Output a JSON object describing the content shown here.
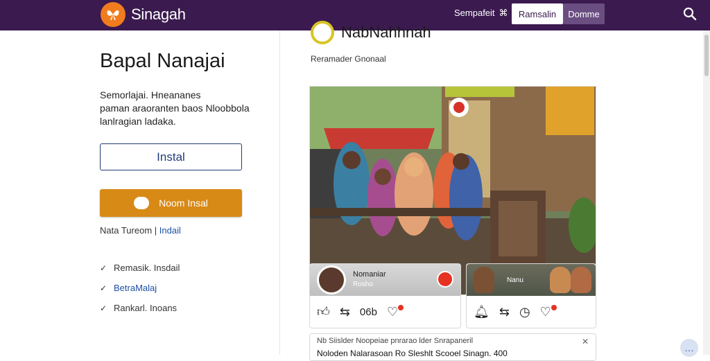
{
  "app": {
    "brand_name": "Sinagah",
    "brand_logo_icon": "butterfly-logo-icon",
    "colors": {
      "topbar": "#3b1a4f",
      "accent_orange": "#d88a17",
      "link_blue": "#1d4fa3",
      "brand_logo": "#f07c1e"
    }
  },
  "header": {
    "nav_link": "Sempafeit",
    "nav_link_icon": "link-icon",
    "button_light": "Ramsalin",
    "button_dark": "Domme",
    "search_icon": "search-icon"
  },
  "left": {
    "title": "Bapal Nanajai",
    "description_lines": [
      "Semorlajai. Hneananes",
      "paman araoranten baos Nloobbola",
      "lanlragian ladaka."
    ],
    "install_button": "Instal",
    "orange_button": "Noom Insal",
    "secondary_prefix": "Nata Tureom",
    "secondary_link": "Indail",
    "checklist": [
      {
        "text": "Remasik. Insdail",
        "style": "plain"
      },
      {
        "text": "BetraMalaj",
        "style": "blue"
      },
      {
        "text": "Rankarl. Inoans",
        "style": "mixed"
      }
    ]
  },
  "post": {
    "title": "NabNahhnah",
    "subtitle": "Reramader Gnonaal",
    "card_a": {
      "name": "Nomaniar",
      "sub": "Rosho"
    },
    "card_b": {
      "label": "Nanu"
    },
    "action_a": {
      "count": "06b"
    },
    "notification_line1": "Nb Siislder  Noopeiae pnrarao lder Snrapaneril",
    "notification_line2": "Noloden Nalarasoan  Ro Sleshlt Scooel Sinagn. 400"
  }
}
